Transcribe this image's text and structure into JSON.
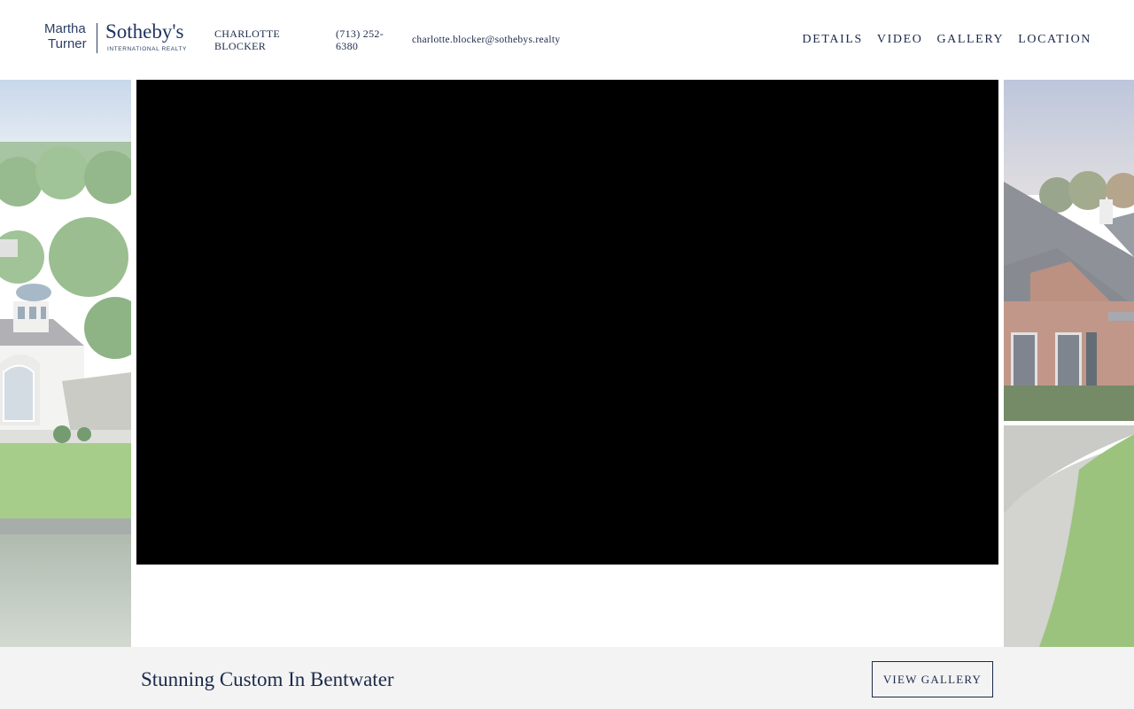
{
  "brand": {
    "line1": "Martha",
    "line2": "Turner",
    "name": "Sotheby's",
    "sub": "INTERNATIONAL REALTY"
  },
  "agent": {
    "name": "CHARLOTTE BLOCKER",
    "phone": "(713) 252-6380",
    "email": "charlotte.blocker@sothebys.realty"
  },
  "nav": {
    "items": [
      {
        "label": "DETAILS"
      },
      {
        "label": "VIDEO"
      },
      {
        "label": "GALLERY"
      },
      {
        "label": "LOCATION"
      }
    ]
  },
  "listing": {
    "title": "Stunning Custom In Bentwater",
    "gallery_button": "VIEW GALLERY"
  },
  "colors": {
    "brand_navy": "#1b2a4a",
    "bottom_bar_bg": "#f3f3f3",
    "video_bg": "#000000"
  }
}
